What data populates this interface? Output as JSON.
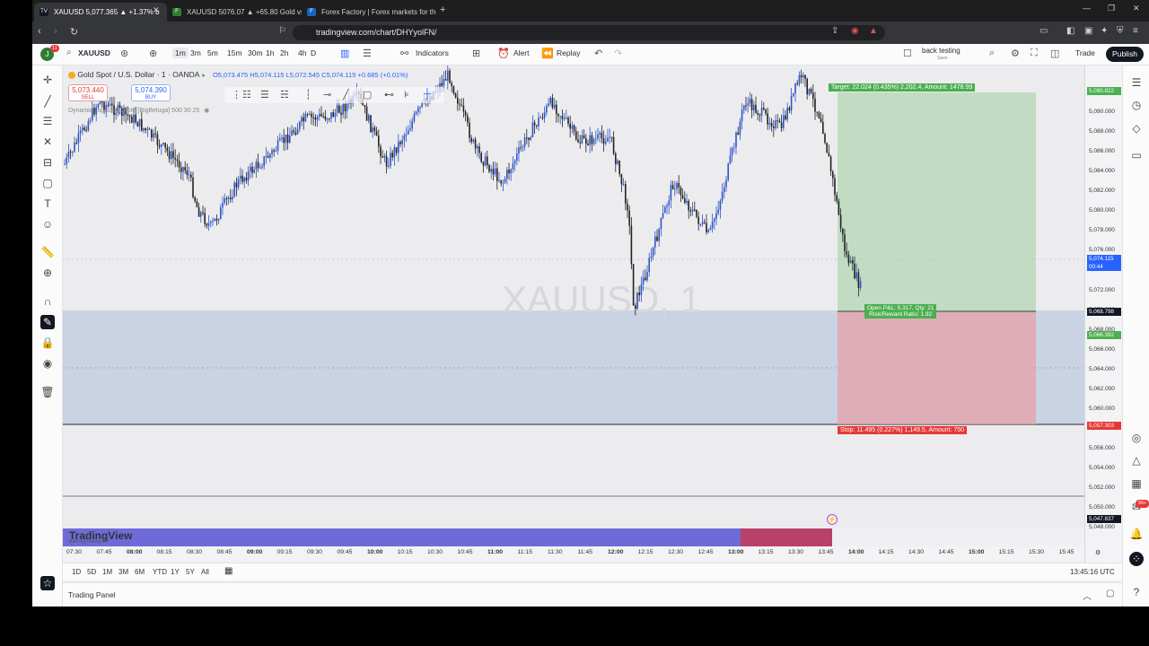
{
  "browser": {
    "tabs": [
      {
        "title": "XAUUSD 5,077.365 ▲ +1.37% b",
        "fav": "TV",
        "favcolor": "#131722"
      },
      {
        "title": "XAUUSD 5076.07 ▲ +65.80 Gold vs U",
        "fav": "FF",
        "favcolor": "#2e7d32"
      },
      {
        "title": "Forex Factory | Forex markets for the",
        "fav": "FF",
        "favcolor": "#1565c0"
      }
    ],
    "url": "tradingview.com/chart/DHYyolFN/"
  },
  "toolbar": {
    "symbol": "XAUUSD",
    "intervals": [
      "1m",
      "3m",
      "5m",
      "15m",
      "30m",
      "1h",
      "2h",
      "4h",
      "D"
    ],
    "indicators": "Indicators",
    "alert": "Alert",
    "replay": "Replay",
    "backtesting": "back testing",
    "save": "Save",
    "trade": "Trade",
    "publish": "Publish",
    "avatar_letter": "J",
    "notif_count": "11"
  },
  "legend": {
    "title": "Gold Spot / U.S. Dollar · 1 · OANDA",
    "ohlc": "O5,073.475 H5,074.115 L5,072.545 C5,074.115 +0.685 (+0.01%)",
    "indicator": "Dynamic Liquidity Depth [BigBeluga] 500 30 25",
    "sell_price": "5,073.440",
    "sell_label": "SELL",
    "buy_price": "5,074.390",
    "buy_label": "BUY"
  },
  "watermark": "XAUUSD, 1",
  "position": {
    "target_label": "Target: 22.024 (0.435%) 2,202.4, Amount: 1478.99",
    "open_label_1": "Open P&L: 5.317, Qty: 21",
    "open_label_2": "Risk/Reward Ratio: 1.92",
    "stop_label": "Stop: 11.495 (0.227%) 1,149.5, Amount: 750"
  },
  "price_axis": {
    "labels": [
      "5,092.000",
      "5,090.000",
      "5,088.000",
      "5,086.000",
      "5,084.000",
      "5,082.000",
      "5,080.000",
      "5,078.000",
      "5,076.000",
      "5,074.000",
      "5,072.000",
      "5,070.000",
      "5,068.000",
      "5,066.000",
      "5,064.000",
      "5,062.000",
      "5,060.000",
      "5,058.000",
      "5,056.000",
      "5,054.000",
      "5,052.000",
      "5,050.000",
      "5,048.000"
    ],
    "tag_target": "5,090.822",
    "tag_current": "5,074.115",
    "tag_countdown": "00:44",
    "tag_entry": "5,068.798",
    "tag_green": "5,066.392",
    "tag_stop": "5,057.303",
    "tag_low": "5,047.837",
    "colors": {
      "target": "#4caf50",
      "current": "#2962ff",
      "entry": "#131722",
      "stop": "#e53935"
    }
  },
  "time_axis": {
    "labels": [
      "07:30",
      "07:45",
      "08:00",
      "08:15",
      "08:30",
      "08:45",
      "09:00",
      "09:15",
      "09:30",
      "09:45",
      "10:00",
      "10:15",
      "10:30",
      "10:45",
      "11:00",
      "11:15",
      "11:30",
      "11:45",
      "12:00",
      "12:15",
      "12:30",
      "12:45",
      "13:00",
      "13:15",
      "13:30",
      "13:45",
      "14:00",
      "14:15",
      "14:30",
      "14:45",
      "15:00",
      "15:15",
      "15:30",
      "15:45"
    ],
    "bold": [
      "08:00",
      "09:00",
      "10:00",
      "11:00",
      "12:00",
      "13:00",
      "14:00",
      "15:00"
    ]
  },
  "brand": {
    "logo": "TradingView",
    "sub": "BullFrogTrading VIP"
  },
  "bottom": {
    "ranges": [
      "1D",
      "5D",
      "1M",
      "3M",
      "6M",
      "YTD",
      "1Y",
      "5Y",
      "All"
    ],
    "clock": "13:45:16 UTC",
    "panel": "Trading Panel"
  },
  "badge_99": "99+"
}
